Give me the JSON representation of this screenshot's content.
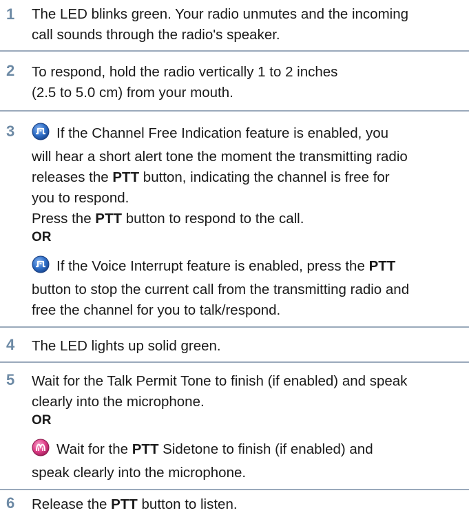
{
  "steps": [
    {
      "number": "1",
      "lines": [
        "The LED blinks green. Your radio unmutes and the incoming",
        "call sounds through the radio's speaker."
      ]
    },
    {
      "number": "2",
      "lines": [
        "To respond, hold the radio vertically 1 to 2 inches",
        "(2.5 to 5.0 cm) from your mouth."
      ]
    },
    {
      "number": "3",
      "block1": {
        "icon": "feature-icon-blue",
        "line1": "If the Channel Free Indication feature is enabled, you",
        "line2": "will hear a short alert tone the moment the transmitting radio",
        "line3_pre": "releases the ",
        "line3_bold": "PTT",
        "line3_post": " button, indicating the channel is free for",
        "line4": "you to respond.",
        "line5_pre": "Press the ",
        "line5_bold": "PTT",
        "line5_post": " button to respond to the call."
      },
      "or_label": "OR",
      "block2": {
        "icon": "feature-icon-blue",
        "line1_pre": "If the Voice Interrupt feature is enabled, press the ",
        "line1_bold": "PTT",
        "line2": "button to stop the current call from the transmitting radio and",
        "line3": "free the channel for you to talk/respond."
      }
    },
    {
      "number": "4",
      "lines": [
        "The LED lights up solid green."
      ]
    },
    {
      "number": "5",
      "line1": "Wait for the Talk Permit Tone to finish (if enabled) and speak",
      "line2": "clearly into the microphone.",
      "or_label": "OR",
      "block2": {
        "icon": "sidetone-icon-pink",
        "line1_pre": "Wait for the ",
        "line1_bold": "PTT",
        "line1_post": " Sidetone to finish (if enabled) and",
        "line2": "speak clearly into the microphone."
      }
    },
    {
      "number": "6",
      "line1_pre": "Release the ",
      "line1_bold": "PTT",
      "line1_post": " button to listen."
    }
  ],
  "colors": {
    "step_number": "#6d8aa5",
    "divider": "#9aa9bb",
    "icon_blue": "#2f6fc8",
    "icon_pink": "#e0408a"
  }
}
